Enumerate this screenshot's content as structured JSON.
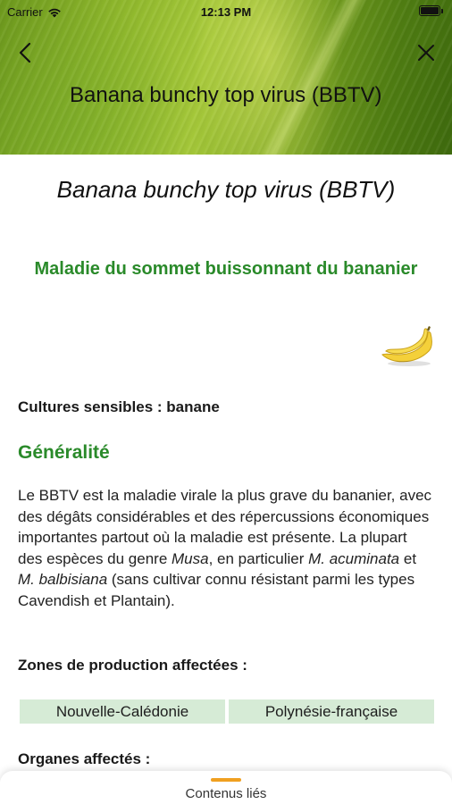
{
  "status_bar": {
    "carrier": "Carrier",
    "time": "12:13 PM"
  },
  "header": {
    "title": "Banana bunchy top virus (BBTV)"
  },
  "icons": {
    "back": "chevron-left-icon",
    "close": "close-icon",
    "wifi": "wifi-icon",
    "battery": "battery-icon",
    "crop": "banana-icon"
  },
  "content": {
    "scientific_name": "Banana bunchy top virus (BBTV)",
    "common_name": "Maladie du sommet buissonnant du bananier",
    "crops_label": "Cultures sensibles : banane",
    "section_title": "Généralité",
    "paragraph": {
      "p1": "Le BBTV est la maladie virale la plus grave du bananier, avec des dégâts considérables et des répercussions économiques importantes partout où la maladie est présente. La plupart des espèces du genre ",
      "i1": "Musa",
      "p2": ", en particulier ",
      "i2": "M. acuminata",
      "p3": " et ",
      "i3": "M. balbisiana",
      "p4": " (sans cultivar connu résistant parmi les types Cavendish et Plantain)."
    },
    "zones_title": "Zones de production affectées :",
    "zones": [
      "Nouvelle-Calédonie",
      "Polynésie-française"
    ],
    "organs_title": "Organes affectés :"
  },
  "bottom_sheet": {
    "label": "Contenus liés"
  },
  "colors": {
    "accent_green": "#2a8a2a",
    "chip_bg": "#d6ebd6",
    "handle": "#f0a020"
  }
}
